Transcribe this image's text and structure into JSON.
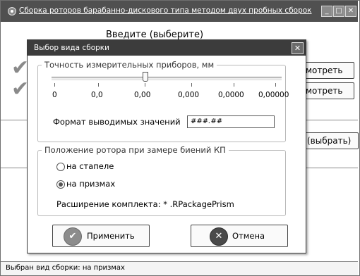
{
  "main_window": {
    "title": "Сборка роторов барабанно-дискового типа методом двух пробных сборок",
    "controls": {
      "minimize": "_",
      "maximize": "□",
      "close": "✕"
    },
    "content_title": "Введите (выберите)",
    "view_button_1": "мотреть",
    "view_button_2": "мотреть",
    "select_button": "(выбрать)",
    "status_text": "Выбран вид сборки: на призмах"
  },
  "dialog": {
    "title": "Выбор вида сборки",
    "close_symbol": "✕",
    "precision_group": {
      "legend": "Точность измерительных приборов, мм",
      "scale_labels": [
        "0",
        "0,0",
        "0,00",
        "0,000",
        "0,0000",
        "0,00000"
      ],
      "selected_index": 2
    },
    "format": {
      "label": "Формат выводимых значений",
      "value": "###.##"
    },
    "position_group": {
      "legend": "Положение ротора при замере биений КП",
      "options": [
        {
          "label": "на стапеле",
          "selected": false
        },
        {
          "label": "на призмах",
          "selected": true
        }
      ],
      "extension_text": "Расширение комплекта: * .RPackagePrism"
    },
    "apply_button": "Применить",
    "cancel_button": "Отмена"
  },
  "colors": {
    "title_bar": "#505050",
    "dialog_title_bar": "#3c3c3c",
    "check": "#8a8a8a",
    "apply_icon": "#8c8c8c",
    "cancel_icon": "#4a4a4a"
  }
}
